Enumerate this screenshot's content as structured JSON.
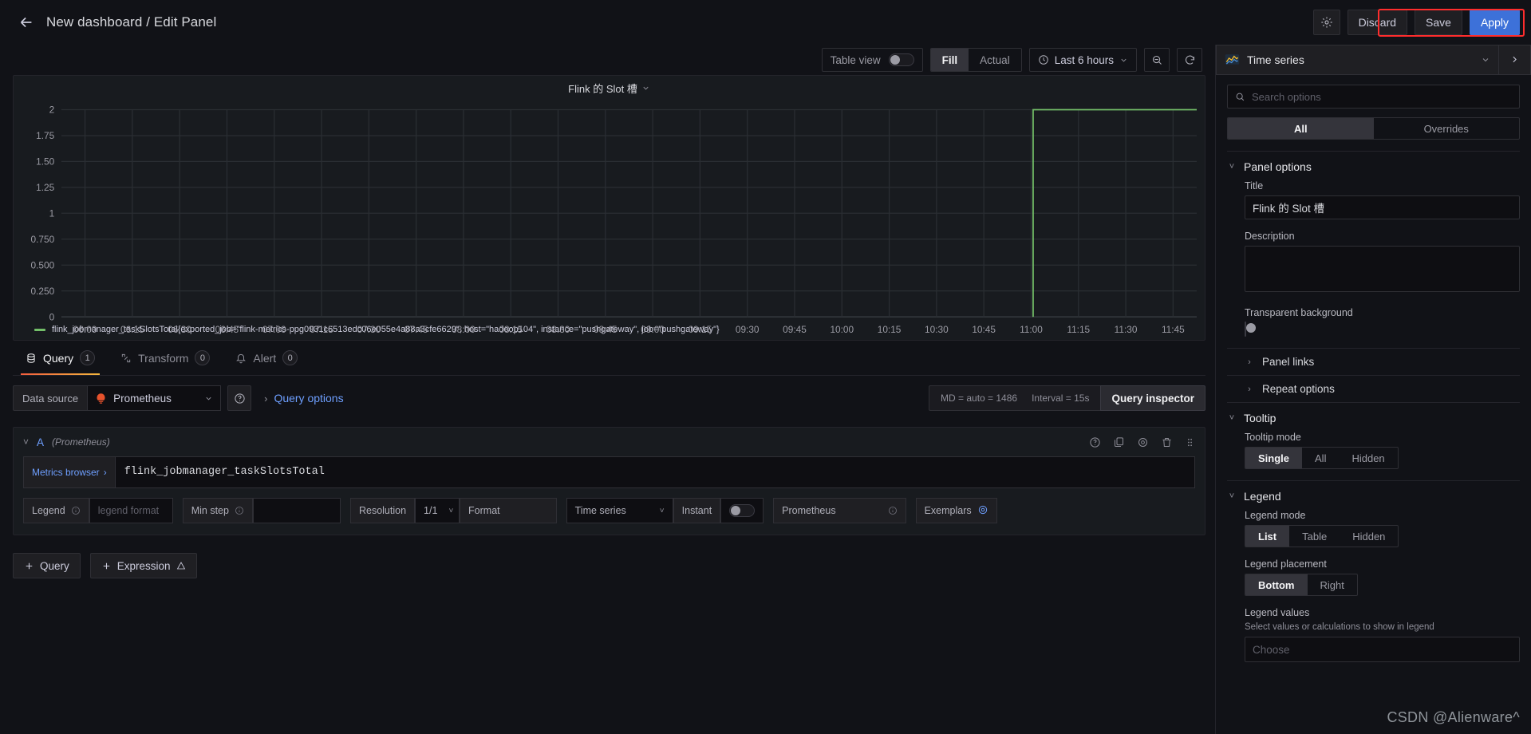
{
  "header": {
    "back_icon": "arrow-left-icon",
    "breadcrumb": "New dashboard / Edit Panel",
    "settings_icon": "gear-icon",
    "discard_label": "Discard",
    "save_label": "Save",
    "apply_label": "Apply",
    "annotation_color": "#ff2d2d"
  },
  "panel_toolbar": {
    "table_view_label": "Table view",
    "table_view_on": false,
    "fill_label": "Fill",
    "actual_label": "Actual",
    "fill_actual_selected": "Fill",
    "time_range": "Last 6 hours",
    "clock_icon": "clock-icon",
    "chevron_icon": "chevron-down-icon",
    "zoom_out_icon": "zoom-out-icon",
    "refresh_icon": "refresh-icon"
  },
  "panel": {
    "title": "Flink 的 Slot 槽",
    "title_chevron": "chevron-down-icon",
    "legend_series": "flink_jobmanager_taskSlotsTotal{exported_job=\"flink-metrics-ppg0931c6513edc06e055e4a88a3cfe6629\", host=\"hadoop104\", instance=\"pushgateway\", job=\"pushgateway\"}",
    "legend_color": "#73bf69"
  },
  "chart_data": {
    "type": "line",
    "title": "Flink 的 Slot 槽",
    "xlabel": "",
    "ylabel": "",
    "grid": true,
    "legend_position": "bottom",
    "ylim": [
      0,
      2
    ],
    "ytick_labels": [
      "2",
      "1.75",
      "1.50",
      "1.25",
      "1",
      "0.750",
      "0.500",
      "0.250",
      "0"
    ],
    "ytick_values": [
      2,
      1.75,
      1.5,
      1.25,
      1,
      0.75,
      0.5,
      0.25,
      0
    ],
    "xtick_labels": [
      "06:00",
      "06:15",
      "06:30",
      "06:45",
      "07:00",
      "07:15",
      "07:30",
      "07:45",
      "08:00",
      "08:15",
      "08:30",
      "08:45",
      "09:00",
      "09:15",
      "09:30",
      "09:45",
      "10:00",
      "10:15",
      "10:30",
      "10:45",
      "11:00",
      "11:15",
      "11:30",
      "11:45"
    ],
    "series": [
      {
        "name": "flink_jobmanager_taskSlotsTotal{exported_job=\"flink-metrics-ppg0931c6513edc06e055e4a88a3cfe6629\", host=\"hadoop104\", instance=\"pushgateway\", job=\"pushgateway\"}",
        "color": "#73bf69",
        "x": [
          "11:00",
          "11:02",
          "11:50"
        ],
        "values": [
          0,
          2,
          2
        ],
        "note": "Flat at 0 (no data) until ~11:00, then steps up to 2 and stays at 2 through the end of range"
      }
    ]
  },
  "query_tabs": {
    "items": [
      {
        "label": "Query",
        "count": "1",
        "icon": "database-icon",
        "active": true
      },
      {
        "label": "Transform",
        "count": "0",
        "icon": "transform-icon",
        "active": false
      },
      {
        "label": "Alert",
        "count": "0",
        "icon": "bell-icon",
        "active": false
      }
    ]
  },
  "datasource_row": {
    "label": "Data source",
    "value": "Prometheus",
    "logo_icon": "prometheus-logo-icon",
    "chevron_icon": "chevron-down-icon",
    "help_icon": "question-circle-icon",
    "query_options_label": "Query options",
    "query_options_caret": "chevron-right-icon",
    "max_data_points": "MD = auto = 1486",
    "interval": "Interval = 15s",
    "query_inspector_label": "Query inspector"
  },
  "query_a": {
    "collapse_icon": "chevron-down-icon",
    "ref_id": "A",
    "datasource": "(Prometheus)",
    "actions": [
      {
        "name": "help-icon"
      },
      {
        "name": "duplicate-icon"
      },
      {
        "name": "hide-response-icon"
      },
      {
        "name": "trash-icon"
      },
      {
        "name": "drag-handle-icon"
      }
    ],
    "metrics_browser_label": "Metrics browser",
    "metrics_browser_caret": "chevron-right-icon",
    "expression": "flink_jobmanager_taskSlotsTotal",
    "options": {
      "legend_label": "Legend",
      "legend_placeholder": "legend format",
      "min_step_label": "Min step",
      "min_step_value": "",
      "resolution_label": "Resolution",
      "resolution_value": "1/1",
      "format_label": "Format",
      "format_value": "Time series",
      "instant_label": "Instant",
      "instant_on": false,
      "type_label": "Prometheus",
      "exemplars_label": "Exemplars",
      "exemplars_icon": "eye-icon",
      "info_icon": "info-circle-icon"
    }
  },
  "add_buttons": {
    "query_label": "Query",
    "expression_label": "Expression",
    "plus_icon": "plus-icon",
    "warning_icon": "warning-triangle-icon"
  },
  "options_pane": {
    "viz_name": "Time series",
    "viz_icon": "time-series-icon",
    "viz_chevron": "chevron-down-icon",
    "viz_next_icon": "chevron-right-icon",
    "search_placeholder": "Search options",
    "search_icon": "search-icon",
    "search_value": "",
    "tab_all": "All",
    "tab_overrides": "Overrides",
    "tab_selected": "All",
    "panel_options": {
      "title": "Panel options",
      "title_label": "Title",
      "title_value": "Flink 的 Slot 槽",
      "description_label": "Description",
      "description_value": "",
      "transparent_label": "Transparent background",
      "transparent_on": false,
      "panel_links": "Panel links",
      "repeat_options": "Repeat options"
    },
    "tooltip": {
      "title": "Tooltip",
      "mode_label": "Tooltip mode",
      "modes": [
        "Single",
        "All",
        "Hidden"
      ],
      "mode_selected": "Single"
    },
    "legend": {
      "title": "Legend",
      "mode_label": "Legend mode",
      "modes": [
        "List",
        "Table",
        "Hidden"
      ],
      "mode_selected": "List",
      "placement_label": "Legend placement",
      "placements": [
        "Bottom",
        "Right"
      ],
      "placement_selected": "Bottom",
      "values_label": "Legend values",
      "values_sub": "Select values or calculations to show in legend",
      "values_placeholder": "Choose"
    }
  },
  "watermark": "CSDN @Alienware^"
}
